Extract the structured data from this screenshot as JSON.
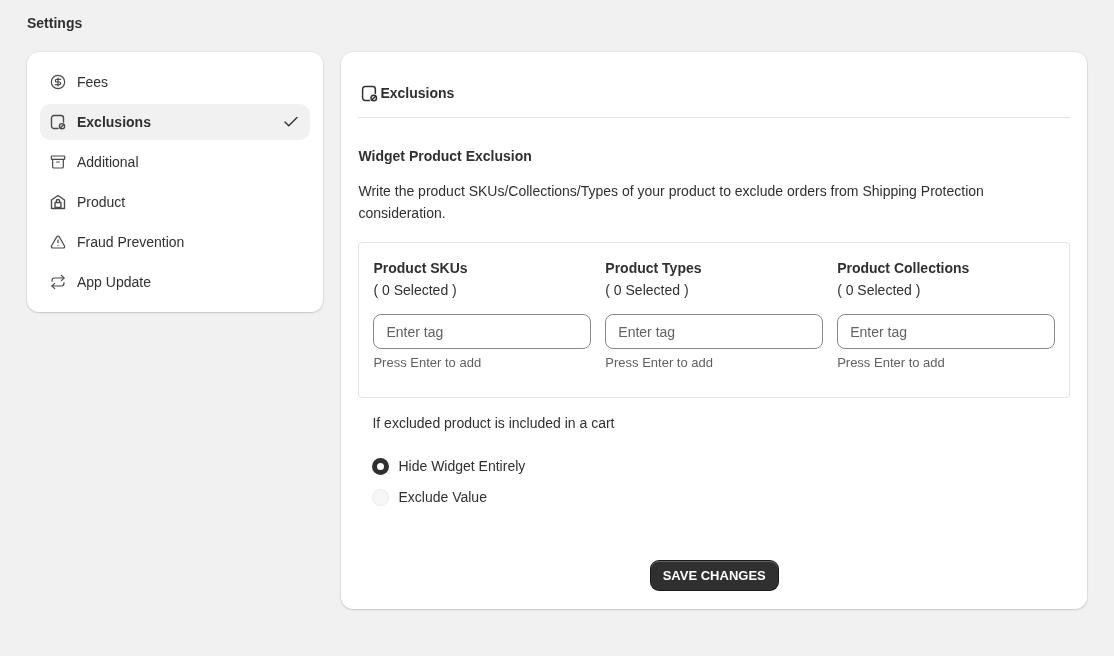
{
  "page_title": "Settings",
  "sidebar": {
    "items": [
      {
        "label": "Fees",
        "selected": false
      },
      {
        "label": "Exclusions",
        "selected": true
      },
      {
        "label": "Additional",
        "selected": false
      },
      {
        "label": "Product",
        "selected": false
      },
      {
        "label": "Fraud Prevention",
        "selected": false
      },
      {
        "label": "App Update",
        "selected": false
      }
    ]
  },
  "panel": {
    "title": "Exclusions",
    "section_title": "Widget Product Exclusion",
    "description": "Write the product SKUs/Collections/Types of your product to exclude orders from Shipping Protection consideration.",
    "fields": [
      {
        "label": "Product SKUs",
        "count": "( 0 Selected )",
        "placeholder": "Enter tag",
        "hint": "Press Enter to add"
      },
      {
        "label": "Product Types",
        "count": "( 0 Selected )",
        "placeholder": "Enter tag",
        "hint": "Press Enter to add"
      },
      {
        "label": "Product Collections",
        "count": "( 0 Selected )",
        "placeholder": "Enter tag",
        "hint": "Press Enter to add"
      }
    ],
    "question": "If excluded product is included in a cart",
    "options": [
      {
        "label": "Hide Widget Entirely",
        "selected": true
      },
      {
        "label": "Exclude Value",
        "selected": false
      }
    ],
    "save_button": "SAVE CHANGES"
  }
}
